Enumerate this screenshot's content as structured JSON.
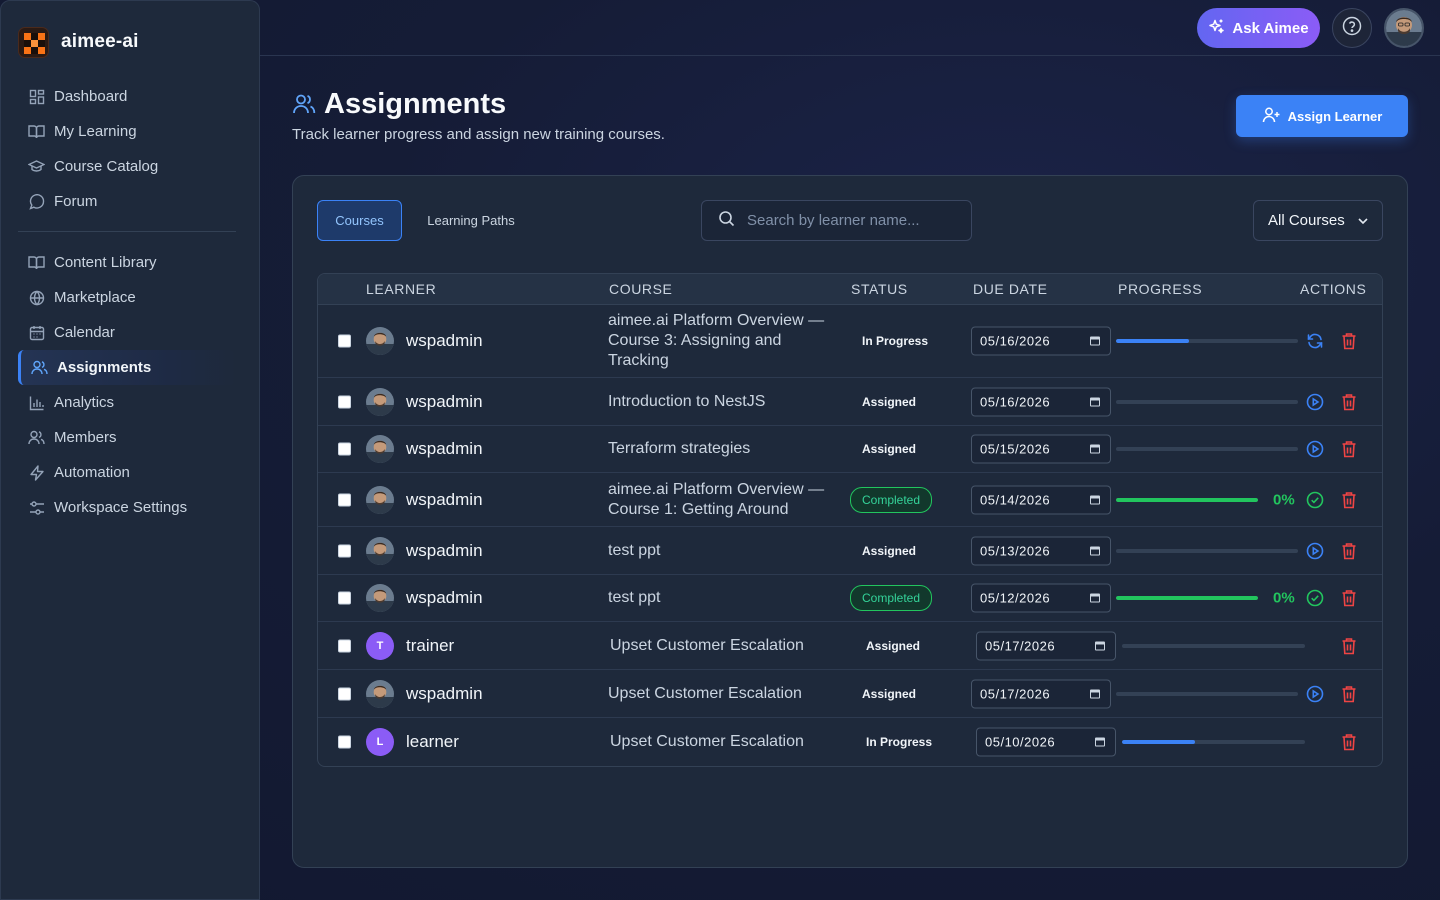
{
  "app": {
    "name": "aimee-ai"
  },
  "topbar": {
    "ask_label": "Ask Aimee"
  },
  "sidebar": {
    "primary": [
      {
        "label": "Dashboard",
        "icon": "grid-icon"
      },
      {
        "label": "My Learning",
        "icon": "book-open-icon"
      },
      {
        "label": "Course Catalog",
        "icon": "graduation-cap-icon"
      },
      {
        "label": "Forum",
        "icon": "message-circle-icon"
      }
    ],
    "secondary": [
      {
        "label": "Content Library",
        "icon": "book-open-icon"
      },
      {
        "label": "Marketplace",
        "icon": "globe-icon"
      },
      {
        "label": "Calendar",
        "icon": "calendar-icon"
      },
      {
        "label": "Assignments",
        "icon": "users-icon",
        "active": true
      },
      {
        "label": "Analytics",
        "icon": "bar-chart-icon"
      },
      {
        "label": "Members",
        "icon": "users-icon"
      },
      {
        "label": "Automation",
        "icon": "zap-icon"
      },
      {
        "label": "Workspace Settings",
        "icon": "sliders-icon"
      }
    ]
  },
  "header": {
    "title": "Assignments",
    "subtitle": "Track learner progress and assign new training courses.",
    "assign_label": "Assign Learner"
  },
  "tabs": {
    "courses": "Courses",
    "paths": "Learning Paths"
  },
  "search": {
    "placeholder": "Search by learner name..."
  },
  "filter": {
    "selected": "All Courses"
  },
  "table": {
    "headers": {
      "learner": "LEARNER",
      "course": "COURSE",
      "status": "STATUS",
      "due": "DUE DATE",
      "progress": "PROGRESS",
      "actions": "ACTIONS"
    },
    "rows": [
      {
        "learner": "wspadmin",
        "course": "aimee.ai Platform Overview — Course 3: Assigning and Tracking",
        "status": "In Progress",
        "due": "05/16/2026",
        "progress": 0.4,
        "pct_label": "",
        "action": "refresh"
      },
      {
        "learner": "wspadmin",
        "course": "Introduction to NestJS",
        "status": "Assigned",
        "due": "05/16/2026",
        "progress": 0,
        "pct_label": "",
        "action": "play"
      },
      {
        "learner": "wspadmin",
        "course": "Terraform strategies",
        "status": "Assigned",
        "due": "05/15/2026",
        "progress": 0,
        "pct_label": "",
        "action": "play"
      },
      {
        "learner": "wspadmin",
        "course": "aimee.ai Platform Overview — Course 1: Getting Around",
        "status": "Completed",
        "due": "05/14/2026",
        "progress": 1,
        "pct_label": "0%",
        "action": "check"
      },
      {
        "learner": "wspadmin",
        "course": "test ppt",
        "status": "Assigned",
        "due": "05/13/2026",
        "progress": 0,
        "pct_label": "",
        "action": "play"
      },
      {
        "learner": "wspadmin",
        "course": "test ppt",
        "status": "Completed",
        "due": "05/12/2026",
        "progress": 1,
        "pct_label": "0%",
        "action": "check"
      },
      {
        "learner": "trainer",
        "avatar_letter": "T",
        "course": "Upset Customer Escalation",
        "status": "Assigned",
        "due": "05/17/2026",
        "progress": 0,
        "pct_label": "",
        "action": "none"
      },
      {
        "learner": "wspadmin",
        "course": "Upset Customer Escalation",
        "status": "Assigned",
        "due": "05/17/2026",
        "progress": 0,
        "pct_label": "",
        "action": "play"
      },
      {
        "learner": "learner",
        "avatar_letter": "L",
        "course": "Upset Customer Escalation",
        "status": "In Progress",
        "due": "05/10/2026",
        "progress": 0.4,
        "pct_label": "",
        "action": "none"
      }
    ]
  },
  "colors": {
    "accent": "#3b82f6",
    "success": "#22c55e",
    "danger": "#ef4444",
    "avatar_letter_bg": "#8b5cf6"
  }
}
